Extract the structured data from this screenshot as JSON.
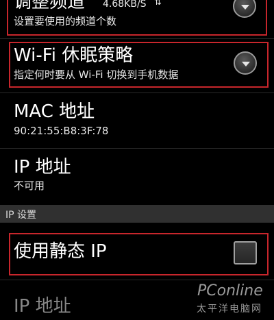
{
  "settings": {
    "channels": {
      "title": "调整频道",
      "speed": "4.68KB/S",
      "speed_icon": "up-down-arrows-icon",
      "subtitle": "设置要使用的频道个数"
    },
    "wifi_sleep": {
      "title": "Wi-Fi 休眠策略",
      "subtitle": "指定何时要从 Wi-Fi 切换到手机数据"
    },
    "mac": {
      "title": "MAC 地址",
      "value": "90:21:55:B8:3F:78"
    },
    "ip": {
      "title": "IP 地址",
      "value": "不可用"
    }
  },
  "ip_settings": {
    "header": "IP 设置",
    "use_static_ip": {
      "label": "使用静态 IP",
      "checked": false
    },
    "ip_address_label": "IP 地址"
  },
  "watermark": {
    "brand": "PConline",
    "chinese": "太平洋电脑网"
  },
  "colors": {
    "highlight": "#c8262c",
    "background": "#000000",
    "section_header": "#303030"
  }
}
